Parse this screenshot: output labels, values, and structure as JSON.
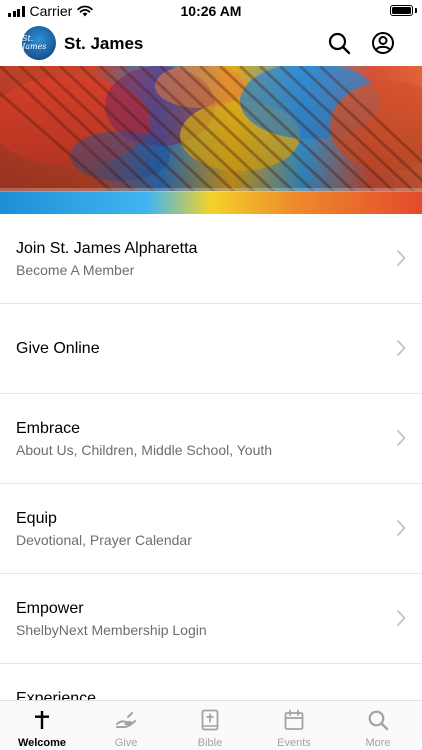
{
  "status_bar": {
    "carrier": "Carrier",
    "time": "10:26 AM",
    "icons": [
      "signal-icon",
      "wifi-icon",
      "battery-icon"
    ]
  },
  "header": {
    "logo_text": "St. James",
    "title": "St. James",
    "icons": [
      "search-icon",
      "account-icon"
    ]
  },
  "menu": {
    "items": [
      {
        "title": "Join St. James Alpharetta",
        "subtitle": "Become A Member"
      },
      {
        "title": "Give Online",
        "subtitle": ""
      },
      {
        "title": "Embrace",
        "subtitle": "About Us, Children, Middle School, Youth"
      },
      {
        "title": "Equip",
        "subtitle": "Devotional, Prayer Calendar"
      },
      {
        "title": "Empower",
        "subtitle": "ShelbyNext Membership Login"
      },
      {
        "title": "Experience",
        "subtitle": ""
      }
    ]
  },
  "tab_bar": {
    "tabs": [
      {
        "label": "Welcome",
        "icon": "cross-icon",
        "active": true
      },
      {
        "label": "Give",
        "icon": "give-hand-icon",
        "active": false
      },
      {
        "label": "Bible",
        "icon": "bible-icon",
        "active": false
      },
      {
        "label": "Events",
        "icon": "calendar-icon",
        "active": false
      },
      {
        "label": "More",
        "icon": "search-icon",
        "active": false
      }
    ]
  },
  "colors": {
    "active_tab": "#000000",
    "inactive_tab": "#a3a3a3",
    "subtitle": "#6d6d6d",
    "divider": "#e6e6e6"
  }
}
